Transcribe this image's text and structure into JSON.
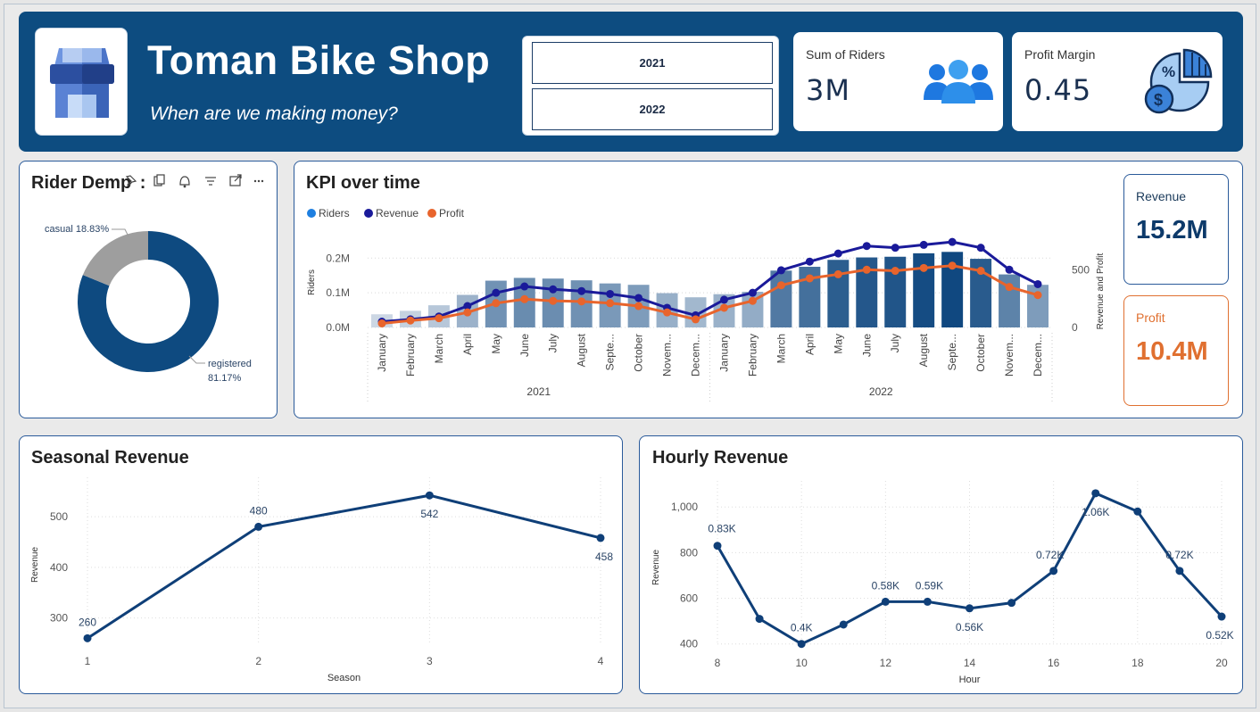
{
  "header": {
    "title": "Toman Bike Shop",
    "subtitle": "When are we making money?",
    "slicer": [
      "2021",
      "2022"
    ],
    "kpis": [
      {
        "label": "Sum of Riders",
        "value": "3M",
        "icon": "people-icon"
      },
      {
        "label": "Profit Margin",
        "value": "0.45",
        "icon": "profit-pie-dollar-icon"
      }
    ]
  },
  "demographic": {
    "title": "Rider Dem",
    "title_overlay": "p :",
    "toolbar_icons": [
      "pin-icon",
      "copy-icon",
      "bell-icon",
      "filter-icon",
      "focus-mode-icon",
      "more-options-icon"
    ],
    "casual_label": "casual 18.83%",
    "registered_label_line1": "registered",
    "registered_label_line2": "81.17%",
    "colors": {
      "registered": "#0e4a80",
      "casual": "#9e9e9e"
    }
  },
  "kpi_over_time": {
    "title": "KPI over time",
    "legend": [
      {
        "name": "Riders",
        "color": "#1e7fe0"
      },
      {
        "name": "Revenue",
        "color": "#1a1a9a"
      },
      {
        "name": "Profit",
        "color": "#e8642c"
      }
    ],
    "ylabel_left": "Riders",
    "ylabel_right": "Revenue and Profit",
    "left_ticks": [
      "0.0M",
      "0.1M",
      "0.2M"
    ],
    "right_ticks": [
      "0",
      "500"
    ],
    "years": [
      "2021",
      "2022"
    ],
    "months": [
      "January",
      "February",
      "March",
      "April",
      "May",
      "June",
      "July",
      "August",
      "Septe...",
      "October",
      "Novem...",
      "Decem...",
      "January",
      "February",
      "March",
      "April",
      "May",
      "June",
      "July",
      "August",
      "Septe...",
      "October",
      "Novem...",
      "Decem..."
    ]
  },
  "side_cards": {
    "revenue_label": "Revenue",
    "revenue_value": "15.2M",
    "profit_label": "Profit",
    "profit_value": "10.4M",
    "revenue_color": "#0d3a6a",
    "profit_color": "#e07030"
  },
  "seasonal": {
    "title": "Seasonal Revenue",
    "xlabel": "Season",
    "ylabel": "Revenue",
    "x_ticks": [
      "1",
      "2",
      "3",
      "4"
    ],
    "y_ticks": [
      "300",
      "400",
      "500"
    ]
  },
  "hourly": {
    "title": "Hourly Revenue",
    "xlabel": "Hour",
    "ylabel": "Revenue",
    "x_ticks": [
      "8",
      "10",
      "12",
      "14",
      "16",
      "18",
      "20"
    ],
    "y_ticks": [
      "400",
      "600",
      "800",
      "1,000"
    ]
  },
  "chart_data": [
    {
      "type": "pie",
      "title": "Rider Dem",
      "slices": [
        {
          "label": "registered",
          "value": 81.17
        },
        {
          "label": "casual",
          "value": 18.83
        }
      ]
    },
    {
      "type": "bar",
      "title": "KPI over time",
      "xlabel": "",
      "ylabel": "Riders",
      "categories": [
        "January",
        "February",
        "March",
        "April",
        "May",
        "June",
        "July",
        "August",
        "Septe...",
        "October",
        "Novem...",
        "Decem...",
        "January",
        "February",
        "March",
        "April",
        "May",
        "June",
        "July",
        "August",
        "Septe...",
        "October",
        "Novem...",
        "Decem..."
      ],
      "ylim": [
        0,
        0.26
      ],
      "y2lim": [
        0,
        780
      ],
      "series": [
        {
          "name": "Riders",
          "axis": "left",
          "unit": "M",
          "values": [
            0.038,
            0.048,
            0.064,
            0.094,
            0.135,
            0.143,
            0.141,
            0.136,
            0.127,
            0.123,
            0.099,
            0.087,
            0.096,
            0.103,
            0.164,
            0.175,
            0.195,
            0.202,
            0.204,
            0.214,
            0.218,
            0.198,
            0.153,
            0.123
          ]
        },
        {
          "name": "Revenue",
          "axis": "right",
          "values": [
            50,
            70,
            95,
            185,
            300,
            355,
            330,
            315,
            290,
            255,
            170,
            105,
            240,
            300,
            495,
            570,
            640,
            705,
            690,
            715,
            740,
            690,
            500,
            375
          ]
        },
        {
          "name": "Profit",
          "axis": "right",
          "values": [
            35,
            60,
            80,
            130,
            210,
            245,
            230,
            225,
            210,
            185,
            130,
            70,
            170,
            230,
            365,
            425,
            460,
            500,
            490,
            515,
            535,
            490,
            350,
            280
          ]
        }
      ]
    },
    {
      "type": "line",
      "title": "Seasonal Revenue",
      "xlabel": "Season",
      "ylabel": "Revenue",
      "x": [
        1,
        2,
        3,
        4
      ],
      "values": [
        260,
        480,
        542,
        458
      ],
      "data_labels": [
        "260",
        "480",
        "542",
        "458"
      ],
      "ylim": [
        250,
        560
      ]
    },
    {
      "type": "line",
      "title": "Hourly Revenue",
      "xlabel": "Hour",
      "ylabel": "Revenue",
      "x": [
        8,
        9,
        10,
        11,
        12,
        13,
        14,
        15,
        16,
        17,
        18,
        19,
        20
      ],
      "values": [
        830,
        510,
        400,
        485,
        585,
        585,
        556,
        580,
        720,
        1060,
        980,
        720,
        520
      ],
      "data_labels": [
        "0.83K",
        "",
        "0.4K",
        "",
        "0.58K",
        "0.59K",
        "0.56K",
        "",
        "0.72K",
        "1.06K",
        "",
        "0.72K",
        "0.52K"
      ],
      "ylim": [
        395,
        1075
      ]
    }
  ]
}
